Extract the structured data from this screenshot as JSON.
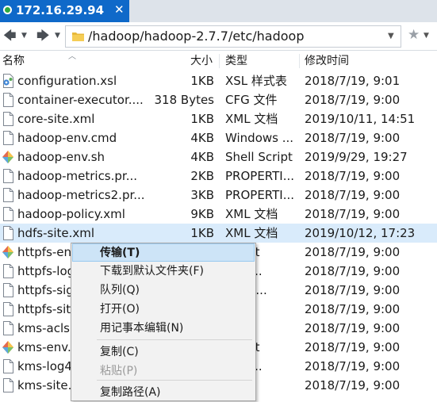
{
  "tab": {
    "title": "172.16.29.94",
    "close_glyph": "✕"
  },
  "toolbar": {
    "back_icon": "back-arrow-icon",
    "forward_icon": "forward-arrow-icon",
    "path": "/hadoop/hadoop-2.7.7/etc/hadoop",
    "bookmark_icon": "star-icon"
  },
  "columns": {
    "name": "名称",
    "size": "大小",
    "type": "类型",
    "modified": "修改时间"
  },
  "files": [
    {
      "name": "configuration.xsl",
      "size": "1KB",
      "type": "XSL 样式表",
      "modified": "2018/7/19, 9:01",
      "icon": "xsl-file-icon"
    },
    {
      "name": "container-executor....",
      "size": "318 Bytes",
      "type": "CFG 文件",
      "modified": "2018/7/19, 9:00",
      "icon": "generic-file-icon"
    },
    {
      "name": "core-site.xml",
      "size": "1KB",
      "type": "XML 文档",
      "modified": "2019/10/11, 14:51",
      "icon": "generic-file-icon"
    },
    {
      "name": "hadoop-env.cmd",
      "size": "4KB",
      "type": "Windows ...",
      "modified": "2018/7/19, 9:00",
      "icon": "generic-file-icon"
    },
    {
      "name": "hadoop-env.sh",
      "size": "4KB",
      "type": "Shell Script",
      "modified": "2019/9/29, 19:27",
      "icon": "shell-script-icon"
    },
    {
      "name": "hadoop-metrics.pr...",
      "size": "2KB",
      "type": "PROPERTI...",
      "modified": "2018/7/19, 9:00",
      "icon": "generic-file-icon"
    },
    {
      "name": "hadoop-metrics2.pr...",
      "size": "3KB",
      "type": "PROPERTI...",
      "modified": "2018/7/19, 9:00",
      "icon": "generic-file-icon"
    },
    {
      "name": "hadoop-policy.xml",
      "size": "9KB",
      "type": "XML 文档",
      "modified": "2018/7/19, 9:00",
      "icon": "generic-file-icon"
    },
    {
      "name": "hdfs-site.xml",
      "size": "1KB",
      "type": "XML 文档",
      "modified": "2019/10/12, 17:23",
      "icon": "generic-file-icon",
      "selected": true
    },
    {
      "name": "httpfs-en",
      "size": "",
      "type": "Script",
      "modified": "2018/7/19, 9:00",
      "icon": "shell-script-icon"
    },
    {
      "name": "httpfs-log",
      "size": "",
      "type": "ERTI...",
      "modified": "2018/7/19, 9:00",
      "icon": "generic-file-icon"
    },
    {
      "name": "httpfs-sig",
      "size": "",
      "type": "ET 文...",
      "modified": "2018/7/19, 9:00",
      "icon": "generic-file-icon"
    },
    {
      "name": "httpfs-sit",
      "size": "",
      "type": "文档",
      "modified": "2018/7/19, 9:00",
      "icon": "generic-file-icon"
    },
    {
      "name": "kms-acls.",
      "size": "",
      "type": "文档",
      "modified": "2018/7/19, 9:00",
      "icon": "generic-file-icon"
    },
    {
      "name": "kms-env.",
      "size": "",
      "type": "Script",
      "modified": "2018/7/19, 9:00",
      "icon": "shell-script-icon"
    },
    {
      "name": "kms-log4",
      "size": "",
      "type": "ERTI...",
      "modified": "2018/7/19, 9:00",
      "icon": "generic-file-icon"
    },
    {
      "name": "kms-site.",
      "size": "",
      "type": "文档",
      "modified": "2018/7/19, 9:00",
      "icon": "generic-file-icon"
    }
  ],
  "context_menu": [
    {
      "label": "传输(T)",
      "highlighted": true
    },
    {
      "label": "下载到默认文件夹(F)"
    },
    {
      "label": "队列(Q)"
    },
    {
      "label": "打开(O)"
    },
    {
      "label": "用记事本编辑(N)"
    },
    {
      "label": "复制(C)"
    },
    {
      "label": "粘贴(P)",
      "disabled": true
    },
    {
      "label": "复制路径(A)"
    }
  ],
  "colors": {
    "tab": "#0f69c9",
    "selection": "#d9ebfb",
    "menu_highlight": "#cde4f7"
  }
}
